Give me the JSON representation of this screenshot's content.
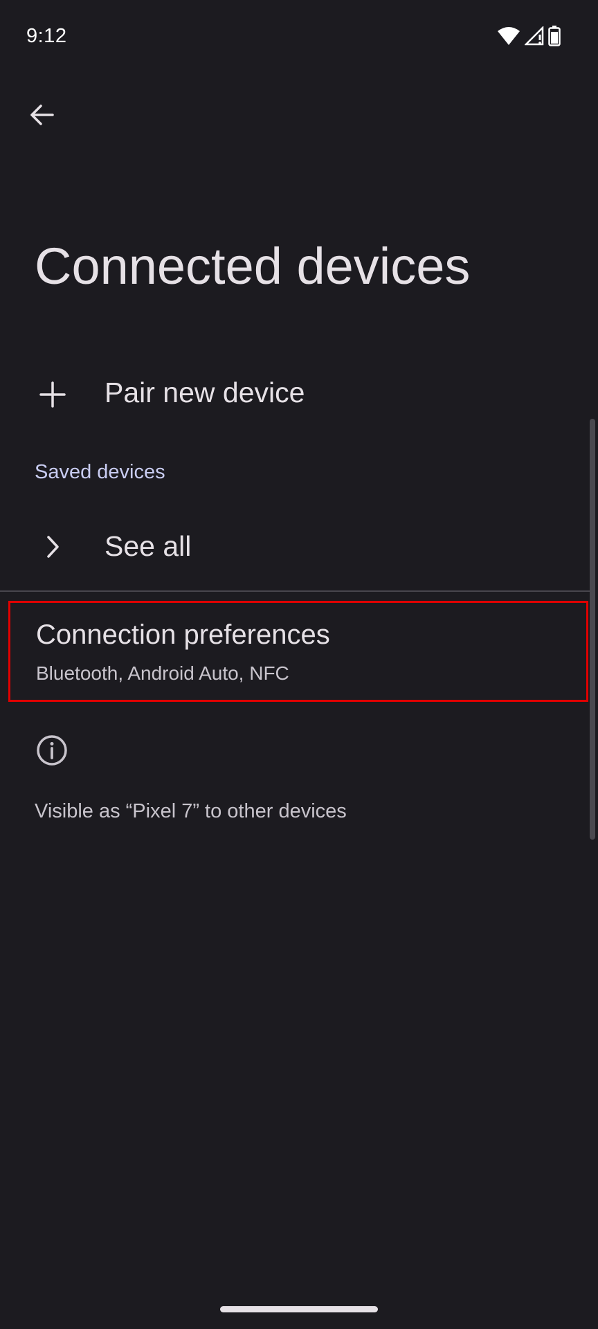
{
  "status_bar": {
    "time": "9:12",
    "icons": [
      "wifi-icon",
      "cellular-no-signal-icon",
      "battery-icon"
    ]
  },
  "header": {
    "back_icon": "arrow-back-icon",
    "title": "Connected devices"
  },
  "pair_new_device": {
    "icon": "plus-icon",
    "label": "Pair new device"
  },
  "saved_devices": {
    "header": "Saved devices",
    "see_all": {
      "icon": "chevron-right-icon",
      "label": "See all"
    }
  },
  "connection_preferences": {
    "title": "Connection preferences",
    "summary": "Bluetooth, Android Auto, NFC",
    "highlighted": true
  },
  "footer": {
    "icon": "info-icon",
    "text": "Visible as “Pixel 7” to other devices"
  },
  "colors": {
    "background": "#1c1b20",
    "text_primary": "#e6e1e6",
    "text_secondary": "#c8c4cc",
    "section_header": "#c9cdf2",
    "highlight_box": "#e00000"
  }
}
